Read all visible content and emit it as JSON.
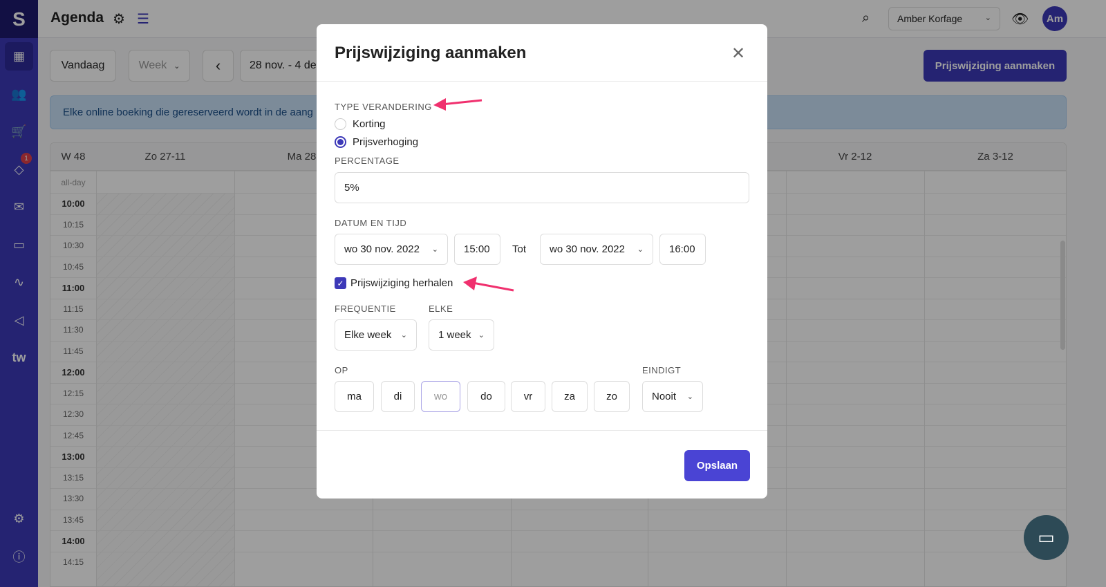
{
  "app": {
    "logo": "S",
    "title": "Agenda",
    "sidebar_badge": "1",
    "sidebar_tw": "tw"
  },
  "header": {
    "user": "Amber Korfage",
    "avatar": "Am"
  },
  "toolbar": {
    "today": "Vandaag",
    "view": "Week",
    "prev": "‹",
    "range": "28 nov. - 4 dec",
    "create": "Prijswijziging aanmaken"
  },
  "info": "Elke online boeking die gereserveerd wordt in de aang",
  "calendar": {
    "week": "W 48",
    "allday": "all-day",
    "days": [
      "Zo 27-11",
      "Ma 28-",
      "",
      "",
      "",
      "Vr 2-12",
      "Za 3-12"
    ],
    "times": [
      "10:00",
      "10:15",
      "10:30",
      "10:45",
      "11:00",
      "11:15",
      "11:30",
      "11:45",
      "12:00",
      "12:15",
      "12:30",
      "12:45",
      "13:00",
      "13:15",
      "13:30",
      "13:45",
      "14:00",
      "14:15"
    ]
  },
  "modal": {
    "title": "Prijswijziging aanmaken",
    "type_label": "TYPE VERANDERING",
    "options": [
      "Korting",
      "Prijsverhoging"
    ],
    "selected": "Prijsverhoging",
    "percentage_label": "PERCENTAGE",
    "percentage": "5%",
    "datetime_label": "DATUM EN TIJD",
    "start_date": "wo 30 nov. 2022",
    "start_time": "15:00",
    "to": "Tot",
    "end_date": "wo 30 nov. 2022",
    "end_time": "16:00",
    "repeat_label": "Prijswijziging herhalen",
    "repeat_checked": true,
    "frequency_label": "FREQUENTIE",
    "frequency": "Elke week",
    "every_label": "ELKE",
    "every": "1 week",
    "on_label": "OP",
    "days": [
      "ma",
      "di",
      "wo",
      "do",
      "vr",
      "za",
      "zo"
    ],
    "selected_day": "wo",
    "ends_label": "EINDIGT",
    "ends": "Nooit",
    "save": "Opslaan"
  },
  "colors": {
    "primary": "#3d39b8",
    "annotation_arrow": "#f0306e"
  }
}
